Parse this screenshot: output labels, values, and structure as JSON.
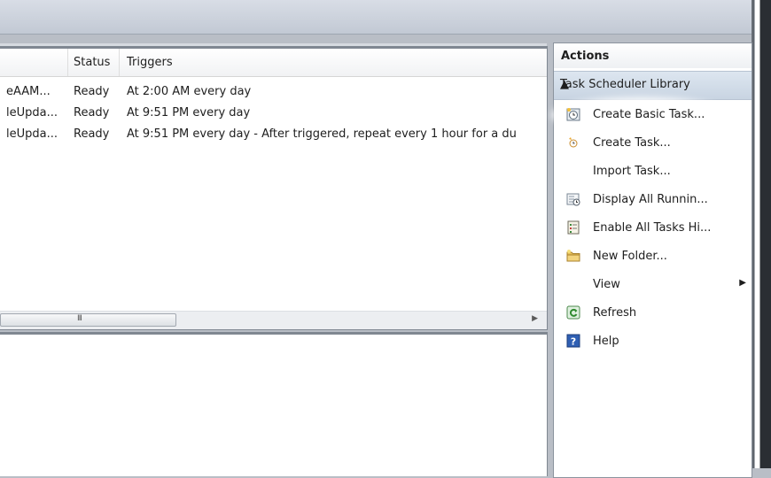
{
  "columns": {
    "status": "Status",
    "triggers": "Triggers"
  },
  "tasks": [
    {
      "name": "eAAM...",
      "status": "Ready",
      "trigger": "At 2:00 AM every day"
    },
    {
      "name": "leUpda...",
      "status": "Ready",
      "trigger": "At 9:51 PM every day"
    },
    {
      "name": "leUpda...",
      "status": "Ready",
      "trigger": "At 9:51 PM every day - After triggered, repeat every 1 hour for a du"
    }
  ],
  "scroll_grip": "III",
  "actions": {
    "title": "Actions",
    "section": "Task Scheduler Library",
    "items": [
      {
        "label": "Create Basic Task...",
        "icon": "create-basic-task-icon"
      },
      {
        "label": "Create Task...",
        "icon": "create-task-icon"
      },
      {
        "label": "Import Task...",
        "icon": ""
      },
      {
        "label": "Display All Runnin...",
        "icon": "display-running-tasks-icon"
      },
      {
        "label": "Enable All Tasks Hi...",
        "icon": "enable-history-icon"
      },
      {
        "label": "New Folder...",
        "icon": "folder-icon"
      },
      {
        "label": "View",
        "icon": ""
      },
      {
        "label": "Refresh",
        "icon": "refresh-icon"
      },
      {
        "label": "Help",
        "icon": "help-icon"
      }
    ]
  },
  "colors": {
    "section_header": "#c8d4e2",
    "background": "#b9bec6",
    "pane_border": "#7f8791"
  }
}
